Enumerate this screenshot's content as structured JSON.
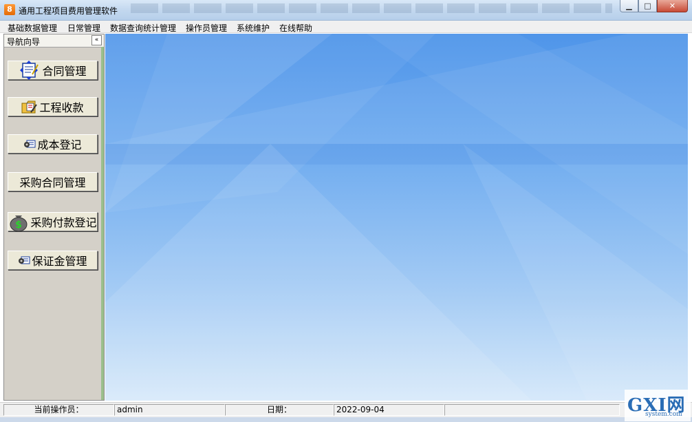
{
  "window": {
    "title": "通用工程项目费用管理软件",
    "app_icon_glyph": "8",
    "buttons": {
      "minimize": "▁",
      "maximize": "□",
      "close": "✕"
    }
  },
  "menu": [
    {
      "label": "基础数据管理"
    },
    {
      "label": "日常管理"
    },
    {
      "label": "数据查询统计管理"
    },
    {
      "label": "操作员管理"
    },
    {
      "label": "系统维护"
    },
    {
      "label": "在线帮助"
    }
  ],
  "nav": {
    "title": "导航向导",
    "collapse_glyph": "«",
    "items": [
      {
        "label": "合同管理",
        "icon": "contract-icon"
      },
      {
        "label": "工程收款",
        "icon": "folder-edit-icon"
      },
      {
        "label": "成本登记",
        "icon": "gear-card-icon"
      },
      {
        "label": "采购合同管理",
        "icon": ""
      },
      {
        "label": "采购付款登记",
        "icon": "money-bag-icon"
      },
      {
        "label": "保证金管理",
        "icon": "gear-card-icon"
      }
    ]
  },
  "status": {
    "operator_label": "当前操作员：",
    "operator_value": "admin",
    "date_label": "日期：",
    "date_value": "2022-09-04"
  },
  "watermark": {
    "big": "GXI网",
    "small": "system.com"
  },
  "colors": {
    "accent": "#4f95e9",
    "nav_bg": "#d4d0c8"
  }
}
